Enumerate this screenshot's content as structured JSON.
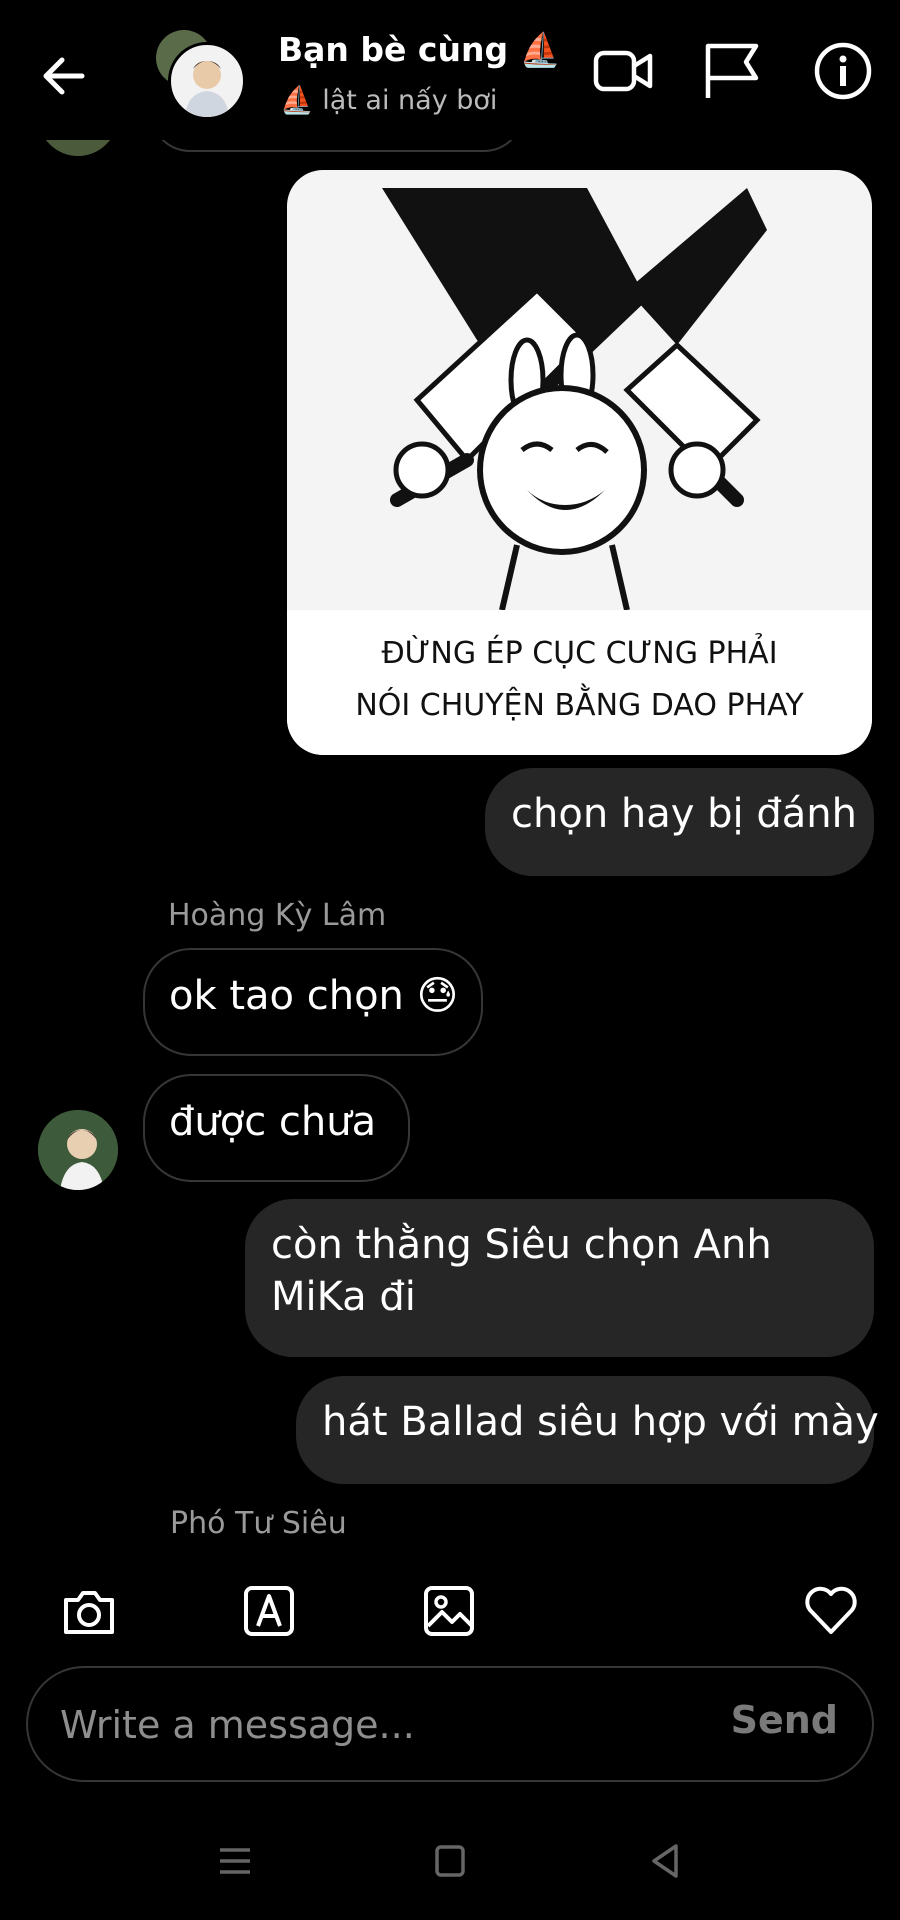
{
  "header": {
    "title": "Bạn bè cùng ⛵",
    "subtitle": "⛵ lật ai nấy bơi",
    "icons": [
      "back-arrow-icon",
      "video-call-icon",
      "flag-icon",
      "info-icon"
    ]
  },
  "messages": {
    "sticker_caption_line1": "ĐỪNG ÉP CỤC CƯNG PHẢI",
    "sticker_caption_line2": "NÓI CHUYỆN BẰNG DAO PHAY",
    "out1": "chọn hay bị đánh",
    "sender1": "Hoàng Kỳ Lâm",
    "in1": "ok tao chọn 😓",
    "in2": "được chưa",
    "out2": "còn thằng Siêu chọn Anh MiKa đi",
    "out3": "hát Ballad siêu hợp với mày",
    "sender2": "Phó Tư Siêu"
  },
  "composer": {
    "placeholder": "Write a message...",
    "send_label": "Send"
  },
  "toolbar": {
    "icons": [
      "camera-icon",
      "text-sticker-icon",
      "gallery-icon",
      "heart-icon"
    ]
  },
  "colors": {
    "background": "#000000",
    "outgoing_bubble": "#262626",
    "incoming_border": "#363636",
    "muted_text": "#8e8e8e"
  }
}
